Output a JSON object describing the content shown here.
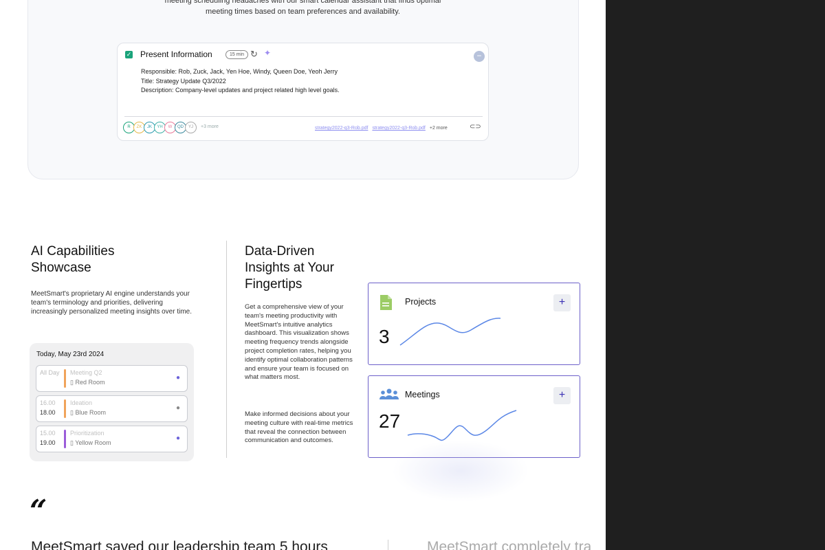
{
  "hero": {
    "text_line1": "meeting scheduling headaches with our smart calendar assistant that finds optimal",
    "text_line2": "meeting times based on team preferences and availability."
  },
  "task": {
    "title": "Present Information",
    "duration": "15 min",
    "responsible": "Responsible: Rob, Zuck, Jack, Yen Hoe, Windy, Queen Doe, Yeoh Jerry",
    "task_title": "Title: Strategy Update Q3/2022",
    "description": "Description: Company-level updates and project related high level goals.",
    "avatars": [
      {
        "initials": "R",
        "color": "#1aa37a"
      },
      {
        "initials": "ZK",
        "color": "#e6b84a"
      },
      {
        "initials": "JK",
        "color": "#2a9ab0"
      },
      {
        "initials": "YH",
        "color": "#3fb0a6"
      },
      {
        "initials": "W",
        "color": "#e87a9a"
      },
      {
        "initials": "QD",
        "color": "#3a8a9e"
      },
      {
        "initials": "YJ",
        "color": "#aaaaaa"
      }
    ],
    "more_avatars": "+3 more",
    "files": [
      "strategy2022-q3-Rob.pdf",
      "strategy2022-q3-Rob.pdf"
    ],
    "more_files": "+2 more"
  },
  "ai": {
    "title_line1": "AI Capabilities",
    "title_line2": "Showcase",
    "description": "MeetSmart's proprietary AI engine understands your team's terminology and priorities, delivering increasingly personalized meeting insights over time.",
    "calendar_date": "Today, May 23rd 2024",
    "events": [
      {
        "time1": "All Day",
        "time2": "",
        "name": "Meeting Q2",
        "room": "Red Room",
        "bar_color": "#f0a35a",
        "chat_color": "#6c63d9"
      },
      {
        "time1": "16.00",
        "time2": "18.00",
        "name": "Ideation",
        "room": "Blue Room",
        "bar_color": "#f0a35a",
        "chat_color": "#888888"
      },
      {
        "time1": "15.00",
        "time2": "19.00",
        "name": "Prioritization",
        "room": "Yellow Room",
        "bar_color": "#9b5cd9",
        "chat_color": "#6c63d9"
      }
    ]
  },
  "data_driven": {
    "title_line1": "Data-Driven",
    "title_line2": "Insights at Your",
    "title_line3": "Fingertips",
    "desc1": "Get a comprehensive view of your team's meeting productivity with MeetSmart's intuitive analytics dashboard. This visualization shows meeting frequency trends alongside project completion rates, helping you identify optimal collaboration patterns and ensure your team is focused on what matters most.",
    "desc2": "Make informed decisions about your meeting culture with real-time metrics that reveal the connection between communication and outcomes.",
    "stats": [
      {
        "label": "Projects",
        "value": "3",
        "icon": "document-icon",
        "icon_color": "#8bc34a"
      },
      {
        "label": "Meetings",
        "value": "27",
        "icon": "people-icon",
        "icon_color": "#5a8fd8"
      }
    ],
    "add_label": "+"
  },
  "testimonial": {
    "quote_mark": "“",
    "text1": "MeetSmart saved our leadership team 5 hours",
    "text2": "MeetSmart completely tra"
  }
}
